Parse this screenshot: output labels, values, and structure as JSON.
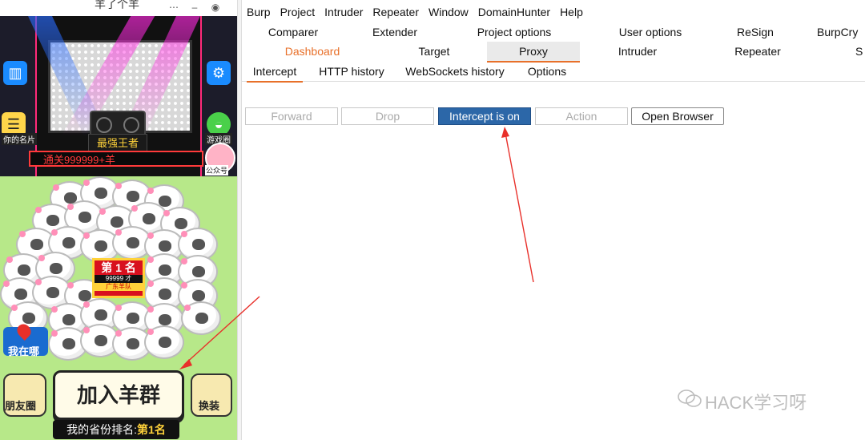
{
  "game": {
    "title": "羊了个羊",
    "top_left_caption": "你的名片",
    "top_right_caption": "游戏圈",
    "account_caption": "公众号",
    "champion_label": "最强王者",
    "ticker_text": "通关999999+羊",
    "rank_board": {
      "title": "第 1 名",
      "score": "99999 才",
      "team": "广东羊队"
    },
    "where_label": "我在哪",
    "friends_label": "朋友圈",
    "join_label": "加入羊群",
    "dress_label": "换装",
    "rank_bar_prefix": "我的省份排名:",
    "rank_bar_value": "第1名"
  },
  "burp": {
    "menu": [
      "Burp",
      "Project",
      "Intruder",
      "Repeater",
      "Window",
      "DomainHunter",
      "Help"
    ],
    "tabs_row1": [
      "Comparer",
      "Extender",
      "Project options",
      "User options",
      "ReSign",
      "BurpCry"
    ],
    "tabs_row2": [
      "Dashboard",
      "Target",
      "Proxy",
      "Intruder",
      "Repeater",
      "S"
    ],
    "active_tab": "Proxy",
    "subtabs": [
      "Intercept",
      "HTTP history",
      "WebSockets history",
      "Options"
    ],
    "active_subtab": "Intercept",
    "buttons": {
      "forward": "Forward",
      "drop": "Drop",
      "intercept": "Intercept is on",
      "action": "Action",
      "open_browser": "Open Browser"
    }
  },
  "watermark": "HACK学习呀",
  "colors": {
    "accent_orange": "#e8702a",
    "intercept_blue": "#2c67a8",
    "arrow_red": "#e8302a"
  }
}
